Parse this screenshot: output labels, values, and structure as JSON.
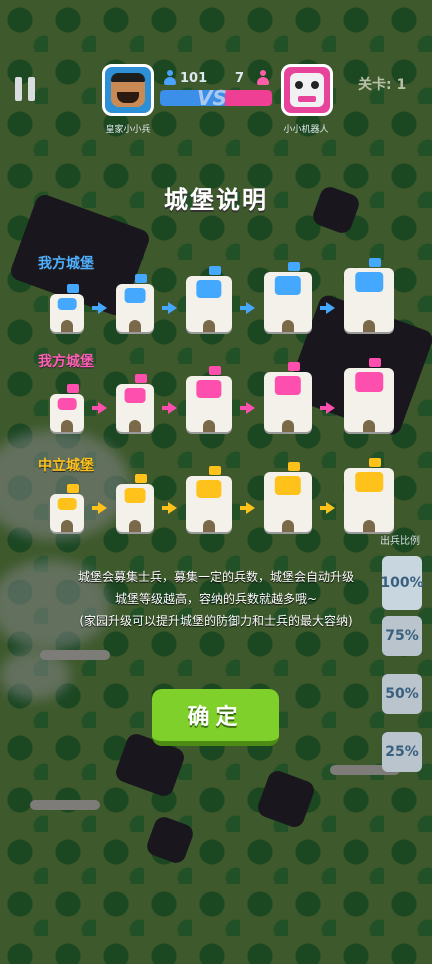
{
  "hud": {
    "player_name": "皇家小小兵",
    "player_count": "101",
    "enemy_name": "小小机器人",
    "enemy_count": "7",
    "vs_label": "VS",
    "level_label": "关卡: 1",
    "player_share": 0.58
  },
  "side_panel": {
    "title": "出兵比例",
    "options": [
      "100%",
      "75%",
      "50%",
      "25%"
    ]
  },
  "dialog": {
    "title": "城堡说明",
    "rows": [
      {
        "label": "我方城堡",
        "color": "#45a8ff"
      },
      {
        "label": "我方城堡",
        "color": "#ff4fae"
      },
      {
        "label": "中立城堡",
        "color": "#ffc21a"
      }
    ],
    "description": [
      "城堡会募集士兵，募集一定的兵数，城堡会自动升级",
      "城堡等级越高，容纳的兵数就越多哦~",
      "(家园升级可以提升城堡的防御力和士兵的最大容纳)"
    ],
    "confirm_label": "确定"
  },
  "colors": {
    "blue": "#45a8ff",
    "pink": "#ff4fae",
    "yellow": "#ffc21a",
    "confirm": "#7fd02a"
  }
}
